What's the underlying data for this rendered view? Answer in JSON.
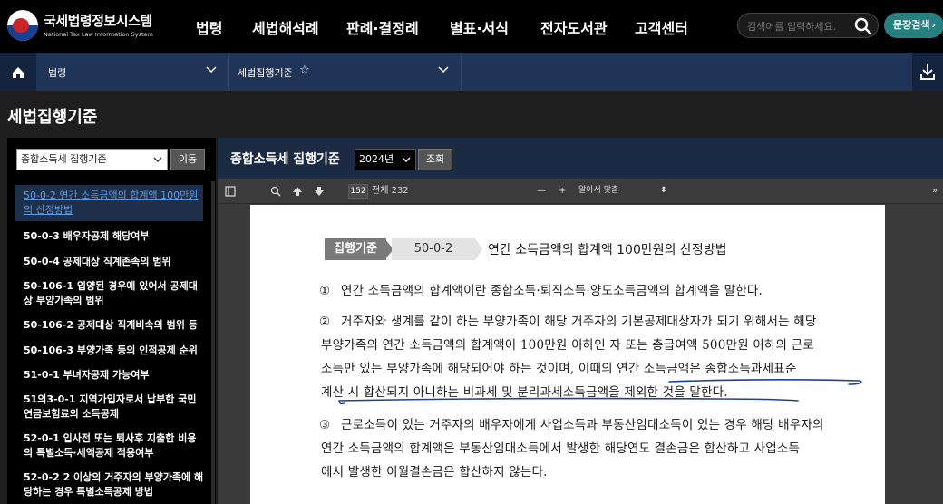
{
  "header": {
    "logo_title": "국세법령정보시스템",
    "logo_subtitle": "National Tax Law Information System",
    "menu": [
      "법령",
      "세법해석례",
      "판례·결정례",
      "별표·서식",
      "전자도서관",
      "고객센터"
    ],
    "search_placeholder": "검색어를 입력하세요.",
    "doc_search_label": "문장검색"
  },
  "breadcrumb": {
    "level1": "법령",
    "level2": "세법집행기준",
    "star": "☆"
  },
  "page_title": "세법집행기준",
  "left_panel": {
    "select_value": "종합소득세 집행기준",
    "move_button": "이동",
    "items": [
      {
        "label": "50-0-2 연간 소득금액의 합계액 100만원의 산정방법",
        "line1": "50-0-2 연간 소득금액의 합계액 100만원",
        "line2": "의 산정방법",
        "active": true
      },
      {
        "label": "50-0-3 배우자공제 해당여부",
        "line1": "50-0-3 배우자공제 해당여부",
        "line2": ""
      },
      {
        "label": "50-0-4 공제대상 직계존속의 범위",
        "line1": "50-0-4 공제대상 직계존속의 범위",
        "line2": ""
      },
      {
        "label": "50-106-1 입양된 경우에 있어서 공제대상 부양가족의 범위",
        "line1": "50-106-1 입양된 경우에 있어서 공제대",
        "line2": "상 부양가족의 범위"
      },
      {
        "label": "50-106-2 공제대상 직계비속의 범위 등",
        "line1": "50-106-2 공제대상 직계비속의 범위 등",
        "line2": ""
      },
      {
        "label": "50-106-3 부양가족 등의 인적공제 순위",
        "line1": "50-106-3 부양가족 등의 인적공제 순위",
        "line2": ""
      },
      {
        "label": "51-0-1 부녀자공제 가능여부",
        "line1": "51-0-1 부녀자공제 가능여부",
        "line2": ""
      },
      {
        "label": "51의3-0-1 지역가입자로서 납부한 국민연금보험료의 소득공제",
        "line1": "51의3-0-1 지역가입자로서 납부한 국민",
        "line2": "연금보험료의 소득공제"
      },
      {
        "label": "52-0-1 입사전 또는 퇴사후 지출한 비용의 특별소득·세액공제 적용여부",
        "line1": "52-0-1 입사전 또는 퇴사후 지출한 비용",
        "line2": "의 특별소득·세액공제 적용여부"
      },
      {
        "label": "52-0-2 2 이상의 거주자의 부양가족에 해당하는 경우 특별소득공제 방법",
        "line1": "52-0-2 2 이상의 거주자의 부양가족에 해",
        "line2": "당하는 경우 특별소득공제 방법"
      }
    ]
  },
  "right_panel": {
    "title": "종합소득세 집행기준",
    "year_value": "2024년",
    "view_button": "조회",
    "pdf_toolbar": {
      "current_page": "152",
      "total_pages": "전체 232",
      "zoom_out": "—",
      "zoom_in": "+",
      "zoom_mode": "알아서 맞춤"
    },
    "document": {
      "tag": "집행기준",
      "code": "50-0-2",
      "title": "연간 소득금액의 합계액 100만원의 산정방법",
      "paragraphs": [
        {
          "num": "①",
          "lines": [
            "연간 소득금액의 합계액이란 종합소득·퇴직소득·양도소득금액의 합계액을 말한다."
          ]
        },
        {
          "num": "②",
          "lines": [
            "거주자와 생계를 같이 하는 부양가족이 해당 거주자의 기본공제대상자가 되기 위해서는 해당",
            "부양가족의 연간 소득금액의 합계액이 100만원 이하인 자 또는 총급여액 500만원 이하의 근로",
            "소득만 있는 부양가족에 해당되어야 하는 것이며, 이때의 연간 소득금액은 종합소득과세표준",
            "계산 시 합산되지 아니하는 비과세 및 분리과세소득금액을 제외한 것을 말한다."
          ]
        },
        {
          "num": "③",
          "lines": [
            "근로소득이 있는 거주자의 배우자에게 사업소득과 부동산임대소득이 있는 경우 해당 배우자의",
            "연간 소득금액의 합계액은 부동산임대소득에서 발생한 해당연도 결손금은 합산하고 사업소득",
            "에서 발생한 이월결손금은 합산하지 않는다."
          ]
        }
      ]
    }
  },
  "colors": {
    "topbar": "#000000",
    "breadcrumb_bar": "#1f3456",
    "doc_search_button": "#27807f",
    "active_link": "#5a9be8",
    "pen_underline": "#1e3f9e"
  }
}
